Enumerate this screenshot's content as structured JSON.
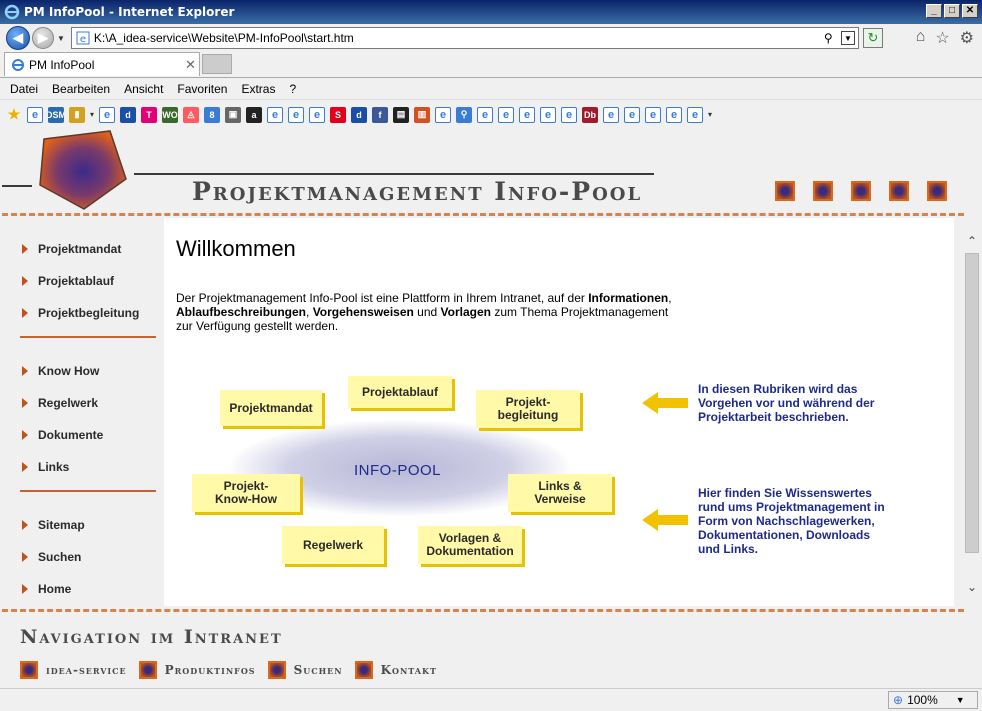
{
  "window": {
    "title": "PM InfoPool - Internet Explorer"
  },
  "address": {
    "url": "K:\\A_idea-service\\Website\\PM-InfoPool\\start.htm"
  },
  "tab": {
    "label": "PM InfoPool"
  },
  "menu": [
    "Datei",
    "Bearbeiten",
    "Ansicht",
    "Favoriten",
    "Extras",
    "?"
  ],
  "favorites": [
    {
      "icon": "star-icon",
      "color": "#e8b400",
      "glyph": "★"
    },
    {
      "icon": "page-icon",
      "color": "#3a7bd5",
      "glyph": "e"
    },
    {
      "icon": "dsm-icon",
      "color": "#2a6ab0",
      "glyph": "DSM"
    },
    {
      "icon": "folder-icon",
      "color": "#d4a020",
      "glyph": "▮"
    },
    {
      "icon": "page-icon",
      "color": "#3a7bd5",
      "glyph": "e"
    },
    {
      "icon": "d-icon",
      "color": "#1a4fa8",
      "glyph": "d"
    },
    {
      "icon": "telekom-icon",
      "color": "#e20074",
      "glyph": "T"
    },
    {
      "icon": "wo-icon",
      "color": "#3a6a2a",
      "glyph": "WO"
    },
    {
      "icon": "airbnb-icon",
      "color": "#ff5a5f",
      "glyph": "◬"
    },
    {
      "icon": "g-icon",
      "color": "#3a7bd5",
      "glyph": "8"
    },
    {
      "icon": "photo-icon",
      "color": "#666",
      "glyph": "▣"
    },
    {
      "icon": "amazon-icon",
      "color": "#222",
      "glyph": "a"
    },
    {
      "icon": "page-icon",
      "color": "#3a7bd5",
      "glyph": "e"
    },
    {
      "icon": "page-icon",
      "color": "#3a7bd5",
      "glyph": "e"
    },
    {
      "icon": "page-icon",
      "color": "#3a7bd5",
      "glyph": "e"
    },
    {
      "icon": "sparkasse-icon",
      "color": "#e2001a",
      "glyph": "S"
    },
    {
      "icon": "d-icon",
      "color": "#1a4fa8",
      "glyph": "d"
    },
    {
      "icon": "facebook-icon",
      "color": "#3b5998",
      "glyph": "f"
    },
    {
      "icon": "flag-icon",
      "color": "#222",
      "glyph": "▤"
    },
    {
      "icon": "chart-icon",
      "color": "#d45020",
      "glyph": "▥"
    },
    {
      "icon": "page-icon",
      "color": "#3a7bd5",
      "glyph": "e"
    },
    {
      "icon": "search-icon",
      "color": "#3a7bd5",
      "glyph": "⚲"
    },
    {
      "icon": "page-icon",
      "color": "#3a7bd5",
      "glyph": "e"
    },
    {
      "icon": "page-icon",
      "color": "#3a7bd5",
      "glyph": "e"
    },
    {
      "icon": "page-icon",
      "color": "#3a7bd5",
      "glyph": "e"
    },
    {
      "icon": "page-icon",
      "color": "#3a7bd5",
      "glyph": "e"
    },
    {
      "icon": "page-icon",
      "color": "#3a7bd5",
      "glyph": "e"
    },
    {
      "icon": "db-icon",
      "color": "#a01c2c",
      "glyph": "Db"
    },
    {
      "icon": "page-icon",
      "color": "#3a7bd5",
      "glyph": "e"
    },
    {
      "icon": "page-icon",
      "color": "#3a7bd5",
      "glyph": "e"
    },
    {
      "icon": "page-icon",
      "color": "#3a7bd5",
      "glyph": "e"
    },
    {
      "icon": "page-icon",
      "color": "#3a7bd5",
      "glyph": "e"
    },
    {
      "icon": "page-icon",
      "color": "#3a7bd5",
      "glyph": "e"
    }
  ],
  "site": {
    "header_title": "Projektmanagement Info-Pool",
    "sidenav": [
      {
        "label": "Projektmandat"
      },
      {
        "label": "Projektablauf"
      },
      {
        "label": "Projektbegleitung"
      },
      {
        "label": "Know How"
      },
      {
        "label": "Regelwerk"
      },
      {
        "label": "Dokumente"
      },
      {
        "label": "Links"
      },
      {
        "label": "Sitemap"
      },
      {
        "label": "Suchen"
      },
      {
        "label": "Home"
      }
    ],
    "welcome": "Willkommen",
    "intro": {
      "t1": "Der Projektmanagement Info-Pool ist eine Plattform in Ihrem Intranet, auf der ",
      "b1": "Informationen",
      "t2": ", ",
      "b2": "Ablaufbeschreibungen",
      "t3": ", ",
      "b3": "Vorgehensweisen",
      "t4": " und ",
      "b4": "Vorlagen",
      "t5": " zum Thema Projektmanagement zur Verfügung gestellt werden."
    },
    "pool_title": "INFO-POOL",
    "notes": {
      "projektmandat": "Projektmandat",
      "projektablauf": "Projektablauf",
      "projektbegleitung_1": "Projekt-",
      "projektbegleitung_2": "begleitung",
      "knowhow_1": "Projekt-",
      "knowhow_2": "Know-How",
      "links_1": "Links &",
      "links_2": "Verweise",
      "regelwerk": "Regelwerk",
      "vorlagen_1": "Vorlagen &",
      "vorlagen_2": "Dokumentation"
    },
    "annotation_1": [
      "In diesen Rubriken wird das",
      "Vorgehen vor und während der",
      "Projektarbeit beschrieben."
    ],
    "annotation_2": [
      "Hier finden Sie Wissenswertes",
      "rund ums Projektmanagement in",
      "Form von Nachschlagewerken,",
      "Dokumentationen, Downloads",
      "und Links."
    ],
    "footer_title": "Navigation im Intranet",
    "footer_links": [
      "idea-service",
      "Produktinfos",
      "Suchen",
      "Kontakt"
    ],
    "accent_color": "#d9824a"
  },
  "status": {
    "zoom": "100%"
  }
}
